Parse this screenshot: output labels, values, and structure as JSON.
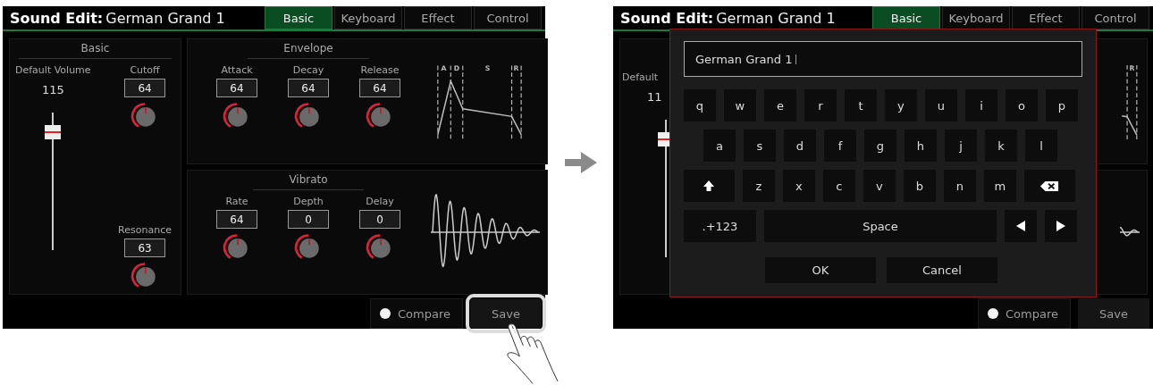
{
  "left_screen": {
    "title": {
      "label": "Sound Edit:",
      "name": "German Grand 1"
    },
    "tabs": [
      {
        "label": "Basic",
        "selected": true
      },
      {
        "label": "Keyboard",
        "selected": false
      },
      {
        "label": "Effect",
        "selected": false
      },
      {
        "label": "Control",
        "selected": false
      }
    ],
    "basic_panel": {
      "title": "Basic",
      "volume": {
        "label": "Default Volume",
        "value": "115",
        "level": 0.9
      },
      "knobs": [
        {
          "label": "Cutoff",
          "value": "64"
        },
        {
          "label": "Resonance",
          "value": "63"
        }
      ]
    },
    "envelope_panel": {
      "title": "Envelope",
      "knobs": [
        {
          "label": "Attack",
          "value": "64"
        },
        {
          "label": "Decay",
          "value": "64"
        },
        {
          "label": "Release",
          "value": "64"
        }
      ],
      "graph_labels": [
        "A",
        "D",
        "S",
        "R"
      ]
    },
    "vibrato_panel": {
      "title": "Vibrato",
      "knobs": [
        {
          "label": "Rate",
          "value": "64"
        },
        {
          "label": "Depth",
          "value": "0"
        },
        {
          "label": "Delay",
          "value": "0"
        }
      ]
    },
    "compare": {
      "label": "Compare"
    },
    "save_button": {
      "label": "Save",
      "highlighted": true
    }
  },
  "right_screen": {
    "title": {
      "label": "Sound Edit:",
      "name": "German Grand 1"
    },
    "tabs": [
      {
        "label": "Basic",
        "selected": true
      },
      {
        "label": "Keyboard",
        "selected": false
      },
      {
        "label": "Effect",
        "selected": false
      },
      {
        "label": "Control",
        "selected": false
      }
    ],
    "volume_label": "Default",
    "volume_value": "11",
    "volume_fader": {
      "level": 0.9
    },
    "graph_labels": [
      "R"
    ],
    "compare": {
      "label": "Compare"
    },
    "save_button": {
      "label": "Save",
      "highlighted": false
    },
    "keyboard_dialog": {
      "value": "German Grand 1",
      "top_row": [
        {
          "kind": "char",
          "label": "q"
        },
        {
          "kind": "char",
          "label": "w"
        },
        {
          "kind": "char",
          "label": "e"
        },
        {
          "kind": "char",
          "label": "r"
        },
        {
          "kind": "char",
          "label": "t"
        },
        {
          "kind": "char",
          "label": "y"
        },
        {
          "kind": "char",
          "label": "u"
        },
        {
          "kind": "char",
          "label": "i"
        },
        {
          "kind": "char",
          "label": "o"
        },
        {
          "kind": "char",
          "label": "p"
        }
      ],
      "middle_row": [
        {
          "kind": "char",
          "label": "a"
        },
        {
          "kind": "char",
          "label": "s"
        },
        {
          "kind": "char",
          "label": "d"
        },
        {
          "kind": "char",
          "label": "f"
        },
        {
          "kind": "char",
          "label": "g"
        },
        {
          "kind": "char",
          "label": "h"
        },
        {
          "kind": "char",
          "label": "j"
        },
        {
          "kind": "char",
          "label": "k"
        },
        {
          "kind": "char",
          "label": "l"
        }
      ],
      "bottom_row": [
        {
          "kind": "shift"
        },
        {
          "kind": "char",
          "label": "z"
        },
        {
          "kind": "char",
          "label": "x"
        },
        {
          "kind": "char",
          "label": "c"
        },
        {
          "kind": "char",
          "label": "v"
        },
        {
          "kind": "char",
          "label": "b"
        },
        {
          "kind": "char",
          "label": "n"
        },
        {
          "kind": "char",
          "label": "m"
        },
        {
          "kind": "backspace"
        }
      ],
      "function_row": [
        {
          "kind": "mode",
          "label": ".+123"
        },
        {
          "kind": "space",
          "label": "Space"
        },
        {
          "kind": "left"
        },
        {
          "kind": "right"
        }
      ],
      "buttons": [
        "OK",
        "Cancel"
      ]
    }
  }
}
